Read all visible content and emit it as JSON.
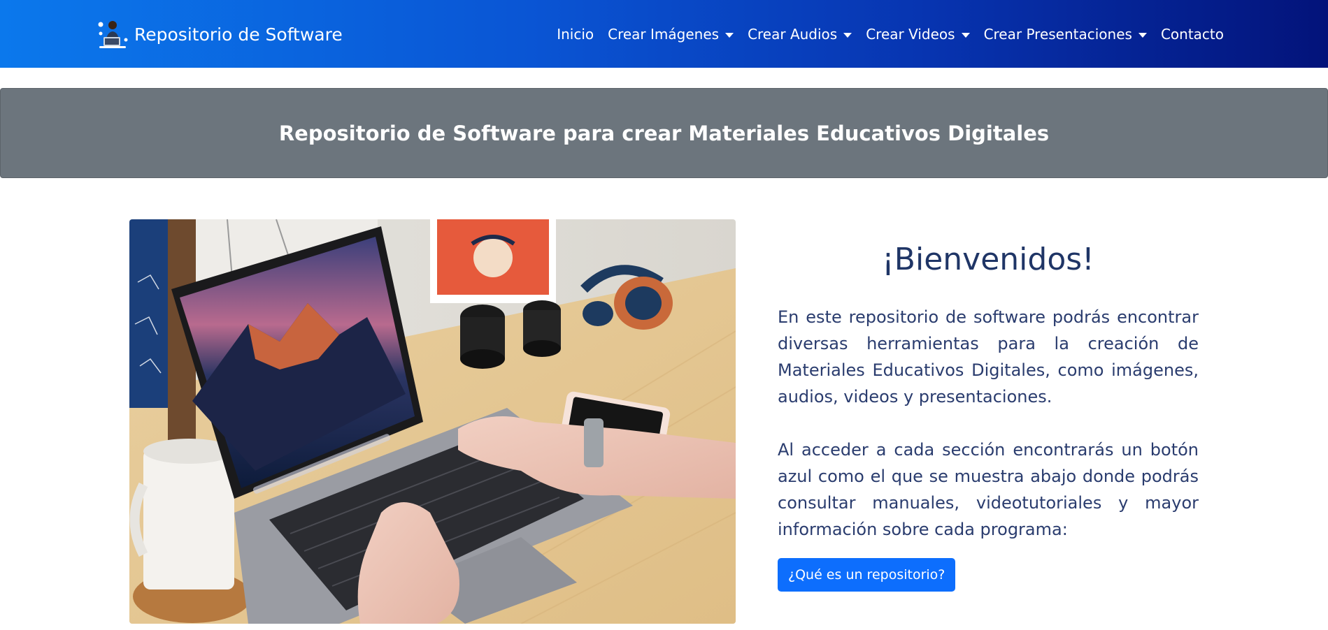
{
  "navbar": {
    "brand": "Repositorio de Software",
    "brand_logo_icon": "person-at-laptop-icon",
    "links": [
      {
        "label": "Inicio",
        "dropdown": false
      },
      {
        "label": "Crear Imágenes",
        "dropdown": true
      },
      {
        "label": "Crear Audios",
        "dropdown": true
      },
      {
        "label": "Crear Videos",
        "dropdown": true
      },
      {
        "label": "Crear Presentaciones",
        "dropdown": true
      },
      {
        "label": "Contacto",
        "dropdown": false
      }
    ]
  },
  "banner": {
    "title": "Repositorio de Software para crear Materiales Educativos Digitales"
  },
  "hero": {
    "photo_subject": "laptop-on-desk-photo"
  },
  "welcome": {
    "title": "¡Bienvenidos!",
    "paragraph1": "En este repositorio de software podrás encontrar diversas herramientas para la creación de Materiales Educativos Digitales, como imágenes, audios, videos y presentaciones.",
    "paragraph2": "Al acceder a cada sección encontrarás un botón azul como el que se muestra abajo donde podrás consultar manuales, videotutoriales y mayor información sobre cada programa:",
    "button_label": "¿Qué es un repositorio?"
  },
  "colors": {
    "nav_gradient_start": "#0b78ec",
    "nav_gradient_end": "#03137a",
    "banner_bg": "#6c757d",
    "primary_button": "#0d6efd",
    "heading_text": "#1f3566"
  }
}
